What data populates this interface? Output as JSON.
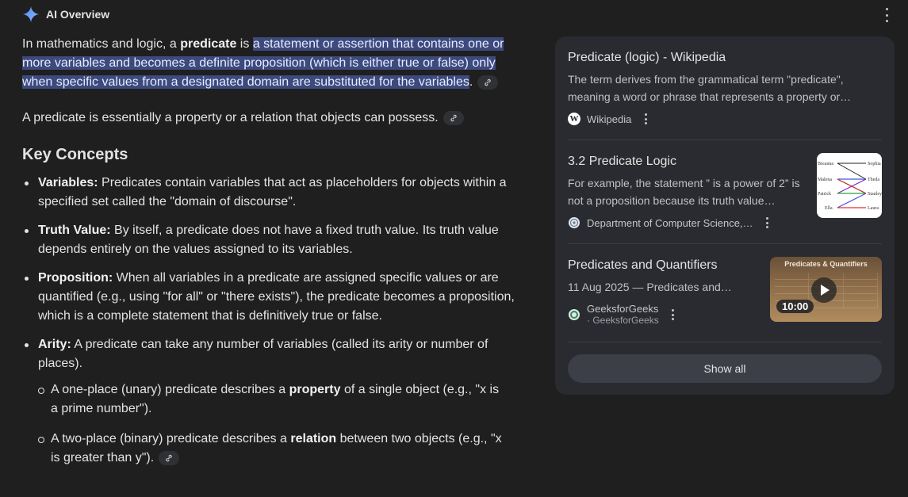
{
  "header": {
    "title": "AI Overview",
    "icon": "sparkle-icon",
    "accent_color": "#4285f4"
  },
  "overview": {
    "p1_before": "In mathematics and logic, a ",
    "p1_bold": "predicate",
    "p1_mid": " is ",
    "p1_highlight": "a statement or assertion that contains one or more variables and becomes a definite proposition (which is either true or false) only when specific values from a designated domain are substituted for the variables",
    "p1_end": ".",
    "p2": "A predicate is essentially a property or a relation that objects can possess.",
    "key_concepts_heading": "Key Concepts",
    "concepts": [
      {
        "term": "Variables:",
        "text": " Predicates contain variables that act as placeholders for objects within a specified set called the \"domain of discourse\"."
      },
      {
        "term": "Truth Value:",
        "text": " By itself, a predicate does not have a fixed truth value. Its truth value depends entirely on the values assigned to its variables."
      },
      {
        "term": "Proposition:",
        "text": " When all variables in a predicate are assigned specific values or are quantified (e.g., using \"for all\" or \"there exists\"), the predicate becomes a proposition, which is a complete statement that is definitively true or false."
      },
      {
        "term": "Arity:",
        "text": " A predicate can take any number of variables (called its arity or number of places)."
      }
    ],
    "arity_sub": [
      {
        "before": "A one-place (unary) predicate describes a ",
        "bold": "property",
        "after": " of a single object (e.g., \"x is a prime number\")."
      },
      {
        "before": "A two-place (binary) predicate describes a ",
        "bold": "relation",
        "after": " between two objects (e.g., \"x is greater than y\")."
      }
    ]
  },
  "sources": [
    {
      "title": "Predicate (logic) - Wikipedia",
      "snippet": "The term derives from the grammatical term \"predicate\", meaning a word or phrase that represents a property or…",
      "site": "Wikipedia",
      "favicon_letter": "W"
    },
    {
      "title": "3.2 Predicate Logic",
      "snippet": "For example, the statement ” is a power of 2” is not a proposition because its truth value…",
      "site": "Department of Computer Science,…",
      "thumb_labels": [
        "Breanna",
        "Malena",
        "Patrick",
        "Ella",
        "Sophia",
        "Theda",
        "Stanley",
        "Laura"
      ]
    },
    {
      "title": "Predicates and Quantifiers",
      "snippet": "11 Aug 2025 — Predicates and…",
      "site": "GeeksforGeeks",
      "site_sub": "· GeeksforGeeks",
      "thumb_title": "Predicates & Quantifiers",
      "duration": "10:00"
    }
  ],
  "show_all_label": "Show all"
}
